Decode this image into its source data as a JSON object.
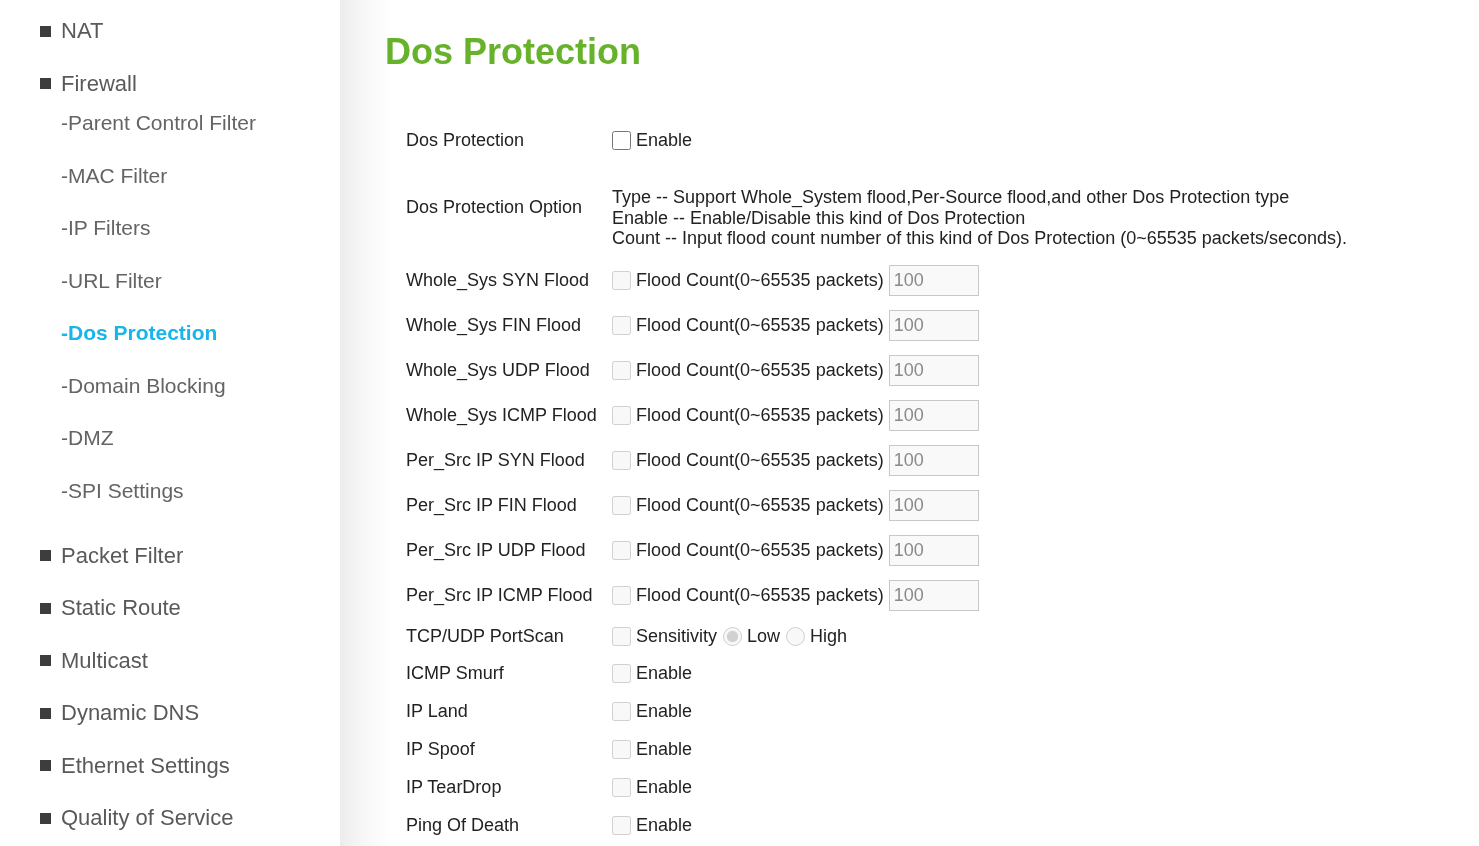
{
  "sidebar": {
    "items": [
      {
        "label": "NAT",
        "selected": false
      },
      {
        "label": "Firewall",
        "selected": false,
        "children": [
          {
            "label": "-Parent Control Filter",
            "selected": false
          },
          {
            "label": "-MAC Filter",
            "selected": false
          },
          {
            "label": "-IP Filters",
            "selected": false
          },
          {
            "label": "-URL Filter",
            "selected": false
          },
          {
            "label": "-Dos Protection",
            "selected": true
          },
          {
            "label": "-Domain Blocking",
            "selected": false
          },
          {
            "label": "-DMZ",
            "selected": false
          },
          {
            "label": "-SPI Settings",
            "selected": false
          }
        ]
      },
      {
        "label": "Packet Filter",
        "selected": false
      },
      {
        "label": "Static Route",
        "selected": false
      },
      {
        "label": "Multicast",
        "selected": false
      },
      {
        "label": "Dynamic DNS",
        "selected": false
      },
      {
        "label": "Ethernet Settings",
        "selected": false
      },
      {
        "label": "Quality of Service",
        "selected": false
      }
    ]
  },
  "page_title": "Dos Protection",
  "form": {
    "rows": [
      {
        "kind": "toggle",
        "label": "Dos Protection",
        "checked": false,
        "disabled": false,
        "option": "Enable"
      },
      {
        "kind": "description",
        "label": "Dos Protection Option",
        "lines": [
          "Type -- Support Whole_System flood,Per-Source flood,and other Dos Protection type",
          "Enable -- Enable/Disable this kind of Dos Protection",
          "Count -- Input flood count number of this kind of Dos Protection (0~65535 packets/seconds)."
        ]
      },
      {
        "kind": "flood",
        "label": "Whole_Sys SYN Flood",
        "checked": false,
        "disabled": true,
        "count_label": "Flood Count(0~65535 packets)",
        "count_value": "100"
      },
      {
        "kind": "flood",
        "label": "Whole_Sys FIN Flood",
        "checked": false,
        "disabled": true,
        "count_label": "Flood Count(0~65535 packets)",
        "count_value": "100"
      },
      {
        "kind": "flood",
        "label": "Whole_Sys UDP Flood",
        "checked": false,
        "disabled": true,
        "count_label": "Flood Count(0~65535 packets)",
        "count_value": "100"
      },
      {
        "kind": "flood",
        "label": "Whole_Sys ICMP Flood",
        "checked": false,
        "disabled": true,
        "count_label": "Flood Count(0~65535 packets)",
        "count_value": "100"
      },
      {
        "kind": "flood",
        "label": "Per_Src IP SYN Flood",
        "checked": false,
        "disabled": true,
        "count_label": "Flood Count(0~65535 packets)",
        "count_value": "100"
      },
      {
        "kind": "flood",
        "label": "Per_Src IP FIN Flood",
        "checked": false,
        "disabled": true,
        "count_label": "Flood Count(0~65535 packets)",
        "count_value": "100"
      },
      {
        "kind": "flood",
        "label": "Per_Src IP UDP Flood",
        "checked": false,
        "disabled": true,
        "count_label": "Flood Count(0~65535 packets)",
        "count_value": "100"
      },
      {
        "kind": "flood",
        "label": "Per_Src IP ICMP Flood",
        "checked": false,
        "disabled": true,
        "count_label": "Flood Count(0~65535 packets)",
        "count_value": "100"
      },
      {
        "kind": "portscan",
        "label": "TCP/UDP PortScan",
        "checked": false,
        "disabled": true,
        "sensitivity_label": "Sensitivity",
        "options": [
          {
            "label": "Low",
            "selected": true
          },
          {
            "label": "High",
            "selected": false
          }
        ]
      },
      {
        "kind": "toggle",
        "label": "ICMP Smurf",
        "checked": false,
        "disabled": true,
        "option": "Enable"
      },
      {
        "kind": "toggle",
        "label": "IP Land",
        "checked": false,
        "disabled": true,
        "option": "Enable"
      },
      {
        "kind": "toggle",
        "label": "IP Spoof",
        "checked": false,
        "disabled": true,
        "option": "Enable"
      },
      {
        "kind": "toggle",
        "label": "IP TearDrop",
        "checked": false,
        "disabled": true,
        "option": "Enable"
      },
      {
        "kind": "toggle",
        "label": "Ping Of Death",
        "checked": false,
        "disabled": true,
        "option": "Enable"
      }
    ]
  }
}
